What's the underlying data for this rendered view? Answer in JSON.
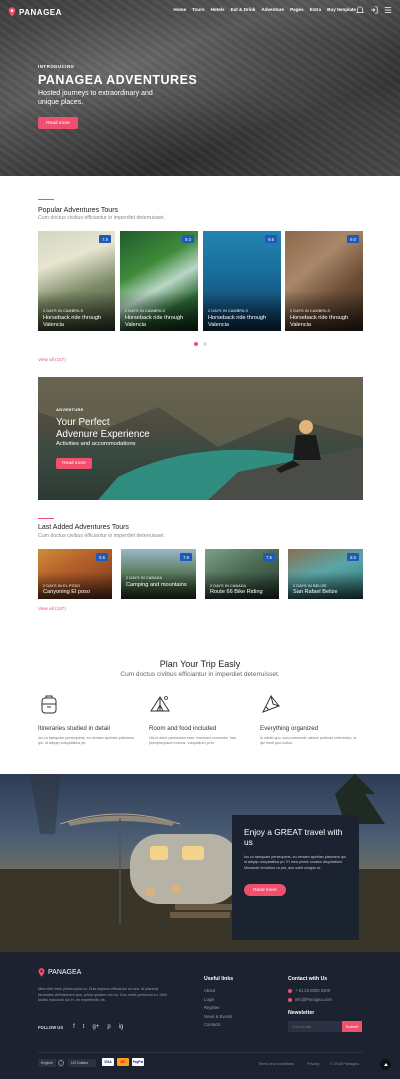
{
  "header": {
    "brand": "PANAGEA",
    "menu": [
      "Home",
      "Tours",
      "Hotels",
      "Eat & Drink",
      "Adventure",
      "Pages",
      "Extra",
      "Buy template"
    ]
  },
  "hero": {
    "intro": "INTRODUCING",
    "title": "PANAGEA ADVENTURES",
    "subtitle": "Hosted journeys to extraordinary and unique places.",
    "button": "Read more"
  },
  "popular": {
    "title": "Popular Adventures Tours",
    "subtitle": "Cum doctus civibus efficiantur in imperdiet deterruisset.",
    "view_all": "View all (157)",
    "cards": [
      {
        "badge": "7.9",
        "meta": "2 DAYS IN CAMBRILS",
        "title": "Horseback ride through Valencia"
      },
      {
        "badge": "9.3",
        "meta": "2 DAYS IN CAMBRILS",
        "title": "Horseback ride through Valencia"
      },
      {
        "badge": "9.5",
        "meta": "2 DAYS IN CAMBRILS",
        "title": "Horseback ride through Valencia"
      },
      {
        "badge": "9.0",
        "meta": "2 DAYS IN CAMBRILS",
        "title": "Horseback ride through Valencia"
      }
    ]
  },
  "banner": {
    "intro": "ADVENTURE",
    "title_line1": "Your Perfect",
    "title_line2": "Advenure Experience",
    "subtitle": "Activities and accommodations",
    "button": "Read more"
  },
  "latest": {
    "title": "Last Added Adventures Tours",
    "subtitle": "Cum doctus civibus efficiantur in imperdiet deterruisset.",
    "view_all": "View all (157)",
    "cards": [
      {
        "badge": "8.5",
        "meta": "2 DAYS IN EL POSO",
        "title": "Canyoning El poso"
      },
      {
        "badge": "7.9",
        "meta": "2 DAYS IN CANADA",
        "title": "Camping and mountains"
      },
      {
        "badge": "7.5",
        "meta": "2 DAYS IN CANADA",
        "title": "Route 66 Bike Riding"
      },
      {
        "badge": "8.0",
        "meta": "2 DAYS IN BELIZE",
        "title": "San Rafael Belize"
      }
    ]
  },
  "plan": {
    "title": "Plan Your Trip Easly",
    "subtitle": "Cum doctus civibus efficiantur in imperdiet deterruisset.",
    "features": [
      {
        "icon": "backpack-icon",
        "title": "Itineraries studied in detail",
        "text": "Ius cu tamquam persequeris, eu veniam apeirian platonem qui, id aliquip voluptatibus pri."
      },
      {
        "icon": "tent-icon",
        "title": "Room and food included",
        "text": "His ei dolor parinomen eam, nominavi convenire, has prompta ipsum numus, voluptatum prim."
      },
      {
        "icon": "compass-icon",
        "title": "Everything organized",
        "text": "In sitnisl quo, cum commodo ratione pertinax referrentur, ut qui fuerit quo iudico."
      }
    ]
  },
  "camp": {
    "title": "Enjoy a GREAT travel with us",
    "text": "Ius cu tamquam persequeris, eu veniam apeirian platonem qui, id aliquip voluptatibus pri. Ei mea primis ornatus disputationi. Menandri erroribus cu per, duo solet congue ut.",
    "button": "Read more"
  },
  "footer": {
    "brand": "PANAGEA",
    "about": "Mea nibh meis philosophia eu. Duis legimus efficiantur ea sea. Id placerat tacimates definitionem sea, prima quidam vim no. Duo nobis persecuti cu. Nihil facilisi indoctum ius in, vix expetendis vis.",
    "follow": "FOLLOW US",
    "social": [
      "f",
      "t",
      "g+",
      "p",
      "ig"
    ],
    "useful_title": "Useful links",
    "useful": [
      "About",
      "Login",
      "Register",
      "News & Events",
      "Contacts"
    ],
    "contact_title": "Contact with Us",
    "phone": "+ 61 23 8093 3400",
    "email": "info@Panagea.com",
    "newsletter_title": "Newsletter",
    "newsletter_placeholder": "Your email",
    "newsletter_button": "Submit",
    "language": "English",
    "currency": "US Dollars",
    "payments": [
      "VISA",
      "MC",
      "PP",
      "PayPal"
    ],
    "terms": "Terms and conditions",
    "privacy": "Privacy",
    "copyright": "© 2018 Panagea"
  },
  "colors": {
    "accent": "#f0506e",
    "badge": "#1e5bb8",
    "footer": "#1c2230"
  }
}
